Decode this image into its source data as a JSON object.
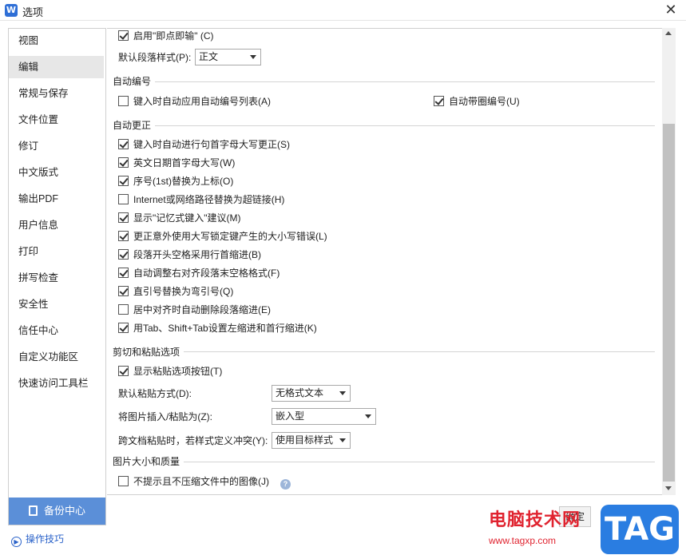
{
  "window": {
    "title": "选项",
    "app_icon": "W"
  },
  "sidebar": {
    "items": [
      {
        "label": "视图",
        "active": false
      },
      {
        "label": "编辑",
        "active": true
      },
      {
        "label": "常规与保存",
        "active": false
      },
      {
        "label": "文件位置",
        "active": false
      },
      {
        "label": "修订",
        "active": false
      },
      {
        "label": "中文版式",
        "active": false
      },
      {
        "label": "输出PDF",
        "active": false
      },
      {
        "label": "用户信息",
        "active": false
      },
      {
        "label": "打印",
        "active": false
      },
      {
        "label": "拼写检查",
        "active": false
      },
      {
        "label": "安全性",
        "active": false
      },
      {
        "label": "信任中心",
        "active": false
      },
      {
        "label": "自定义功能区",
        "active": false
      },
      {
        "label": "快速访问工具栏",
        "active": false
      }
    ],
    "backup_label": "备份中心",
    "tips_label": "操作技巧"
  },
  "top": {
    "instant_input": {
      "label": "启用\"即点即输\" (C)",
      "checked": true
    },
    "default_style_label": "默认段落样式(P):",
    "default_style_value": "正文"
  },
  "auto_number": {
    "title": "自动编号",
    "auto_list": {
      "label": "键入时自动应用自动编号列表(A)",
      "checked": false
    },
    "circle_number": {
      "label": "自动带圈编号(U)",
      "checked": true
    }
  },
  "auto_correct": {
    "title": "自动更正",
    "items": [
      {
        "label": "键入时自动进行句首字母大写更正(S)",
        "checked": true
      },
      {
        "label": "英文日期首字母大写(W)",
        "checked": true
      },
      {
        "label": "序号(1st)替换为上标(O)",
        "checked": true
      },
      {
        "label": "Internet或网络路径替换为超链接(H)",
        "checked": false
      },
      {
        "label": "显示\"记忆式键入\"建议(M)",
        "checked": true
      },
      {
        "label": "更正意外使用大写锁定键产生的大小写错误(L)",
        "checked": true
      },
      {
        "label": "段落开头空格采用行首缩进(B)",
        "checked": true
      },
      {
        "label": "自动调整右对齐段落末空格格式(F)",
        "checked": true
      },
      {
        "label": "直引号替换为弯引号(Q)",
        "checked": true
      },
      {
        "label": "居中对齐时自动删除段落缩进(E)",
        "checked": false
      },
      {
        "label": "用Tab、Shift+Tab设置左缩进和首行缩进(K)",
        "checked": true
      }
    ]
  },
  "paste": {
    "title": "剪切和粘贴选项",
    "show_button": {
      "label": "显示粘贴选项按钮(T)",
      "checked": true
    },
    "default_paste_label": "默认粘贴方式(D):",
    "default_paste_value": "无格式文本",
    "image_insert_label": "将图片插入/粘贴为(Z):",
    "image_insert_value": "嵌入型",
    "cross_doc_label": "跨文档粘贴时，若样式定义冲突(Y):",
    "cross_doc_value": "使用目标样式"
  },
  "image_quality": {
    "title": "图片大小和质量",
    "no_compress": {
      "label": "不提示且不压缩文件中的图像(J)",
      "checked": false
    }
  },
  "footer": {
    "ok_label": "确定"
  },
  "watermark": {
    "site_name": "电脑技术网",
    "url": "www.tagxp.com",
    "tag": "TAG"
  },
  "colors": {
    "accent": "#5b8fd8",
    "link": "#2a62c9",
    "watermark_red": "#e0232f",
    "tag_blue": "#2a7de1"
  }
}
